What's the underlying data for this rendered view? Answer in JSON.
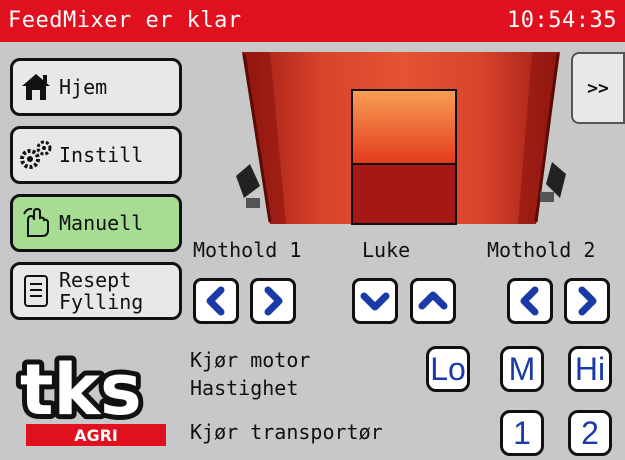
{
  "header": {
    "title": "FeedMixer er klar",
    "time": "10:54:35"
  },
  "nav": {
    "home": "Hjem",
    "settings": "Instill",
    "manual": "Manuell",
    "recipe_line1": "Resept",
    "recipe_line2": "Fylling"
  },
  "expand_label": ">>",
  "sections": {
    "counter1": "Mothold 1",
    "hatch": "Luke",
    "counter2": "Mothold 2"
  },
  "motor": {
    "line1": "Kjør motor",
    "line2": "Hastighet",
    "lo": "Lo",
    "m": "M",
    "hi": "Hi"
  },
  "conveyor": {
    "label": "Kjør transportør",
    "btn1": "1",
    "btn2": "2"
  },
  "logo": {
    "text": "tks",
    "sub": "AGRI"
  },
  "colors": {
    "header": "#e0101e",
    "active_nav": "#a6dd93",
    "arrow_blue": "#1a3aa8",
    "background": "#c8c8c8"
  }
}
